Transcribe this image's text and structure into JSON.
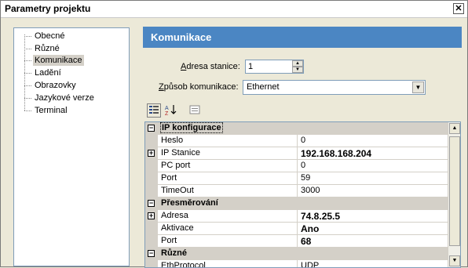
{
  "window": {
    "title": "Parametry projektu",
    "close_glyph": "✕"
  },
  "tree": {
    "items": [
      {
        "label": "Obecné"
      },
      {
        "label": "Různé"
      },
      {
        "label": "Komunikace",
        "selected": true
      },
      {
        "label": "Ladění"
      },
      {
        "label": "Obrazovky"
      },
      {
        "label": "Jazykové verze"
      },
      {
        "label": "Terminal"
      }
    ]
  },
  "panel": {
    "header": "Komunikace",
    "station": {
      "label_prefix": "",
      "label_ul": "A",
      "label_rest": "dresa stanice:",
      "value": "1"
    },
    "comm": {
      "label_ul": "Z",
      "label_rest": "působ komunikace:",
      "value": "Ethernet"
    }
  },
  "toolbar": {
    "categorized_icon": "categorized-icon",
    "alphabetical_icon": "alphabetical-icon",
    "pages_icon": "property-pages-icon"
  },
  "grid": {
    "rows": [
      {
        "type": "category",
        "name": "IP konfigurace"
      },
      {
        "type": "prop",
        "name": "Heslo",
        "value": "0"
      },
      {
        "type": "prop",
        "name": "IP Stanice",
        "value": "192.168.168.204",
        "expandable": true,
        "bold": true
      },
      {
        "type": "prop",
        "name": "PC port",
        "value": "0"
      },
      {
        "type": "prop",
        "name": "Port",
        "value": "59"
      },
      {
        "type": "prop",
        "name": "TimeOut",
        "value": "3000"
      },
      {
        "type": "category",
        "name": "Přesměrování"
      },
      {
        "type": "prop",
        "name": "Adresa",
        "value": "74.8.25.5",
        "expandable": true,
        "bold": true
      },
      {
        "type": "prop",
        "name": "Aktivace",
        "value": "Ano",
        "bold": true
      },
      {
        "type": "prop",
        "name": "Port",
        "value": "68",
        "bold": true
      },
      {
        "type": "category",
        "name": "Různé"
      },
      {
        "type": "prop",
        "name": "EthProtocol",
        "value": "UDP"
      }
    ]
  }
}
